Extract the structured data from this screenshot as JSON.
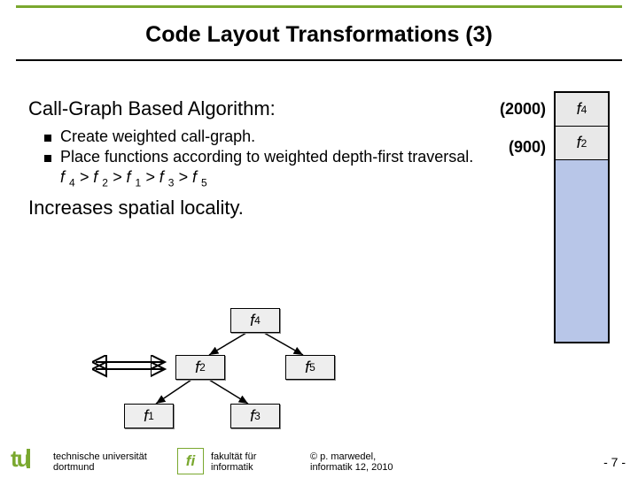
{
  "title": "Code Layout Transformations (3)",
  "algo_title": "Call-Graph Based Algorithm:",
  "bullets": [
    "Create weighted call-graph.",
    "Place functions according to weighted depth-first traversal."
  ],
  "order_html": "f 4 > f 2 > f 1 > f 3 > f 5",
  "increase": "Increases spatial locality.",
  "weights": {
    "w1": "(2000)",
    "w2": "(900)"
  },
  "mem": {
    "c1": "f4",
    "c2": "f2"
  },
  "tree": {
    "f4": "f4",
    "f2": "f2",
    "f5": "f5",
    "f1": "f1",
    "f3": "f3"
  },
  "footer": {
    "tu": "tu",
    "uni1": "technische universität",
    "uni2": "dortmund",
    "fi": "fi",
    "fak1": "fakultät für",
    "fak2": "informatik",
    "cpy1": "©  p. marwedel,",
    "cpy2": "informatik 12,  2010",
    "page": "-   7 -"
  }
}
